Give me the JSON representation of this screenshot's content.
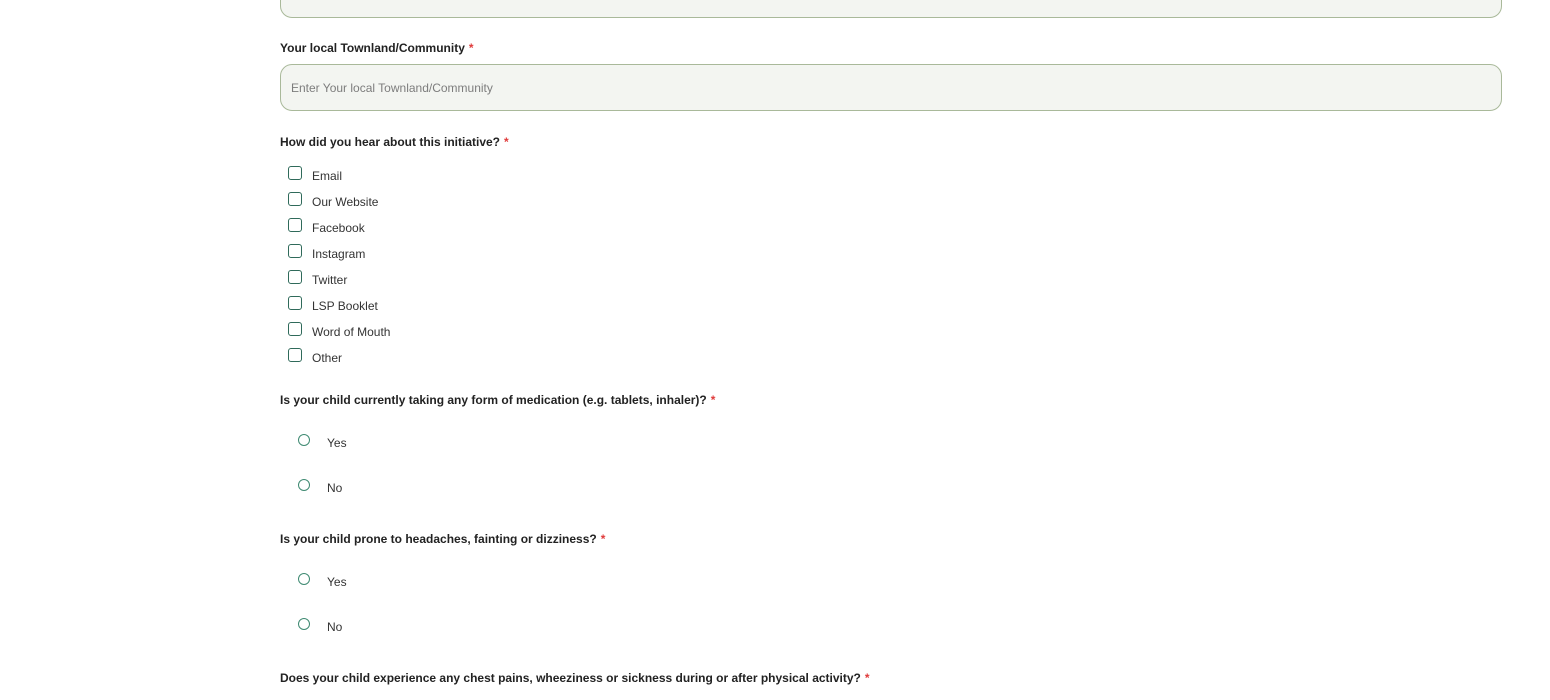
{
  "townland_field": {
    "label": "Your local Townland/Community",
    "required_mark": "*",
    "placeholder": "Enter Your local Townland/Community",
    "value": ""
  },
  "hear_about": {
    "label": "How did you hear about this initiative?",
    "required_mark": "*",
    "options": [
      "Email",
      "Our Website",
      "Facebook",
      "Instagram",
      "Twitter",
      "LSP Booklet",
      "Word of Mouth",
      "Other"
    ]
  },
  "medication_q": {
    "label": "Is your child currently taking any form of medication (e.g. tablets, inhaler)?",
    "required_mark": "*",
    "options": [
      "Yes",
      "No"
    ]
  },
  "headaches_q": {
    "label": "Is your child prone to headaches, fainting or dizziness?",
    "required_mark": "*",
    "options": [
      "Yes",
      "No"
    ]
  },
  "chest_q": {
    "label": "Does your child experience any chest pains, wheeziness or sickness during or after physical activity?",
    "required_mark": "*"
  },
  "colors": {
    "accent": "#2f6a5a",
    "required": "#e03b3b",
    "field_bg": "#f3f5f1",
    "field_border": "#a9b99a"
  }
}
